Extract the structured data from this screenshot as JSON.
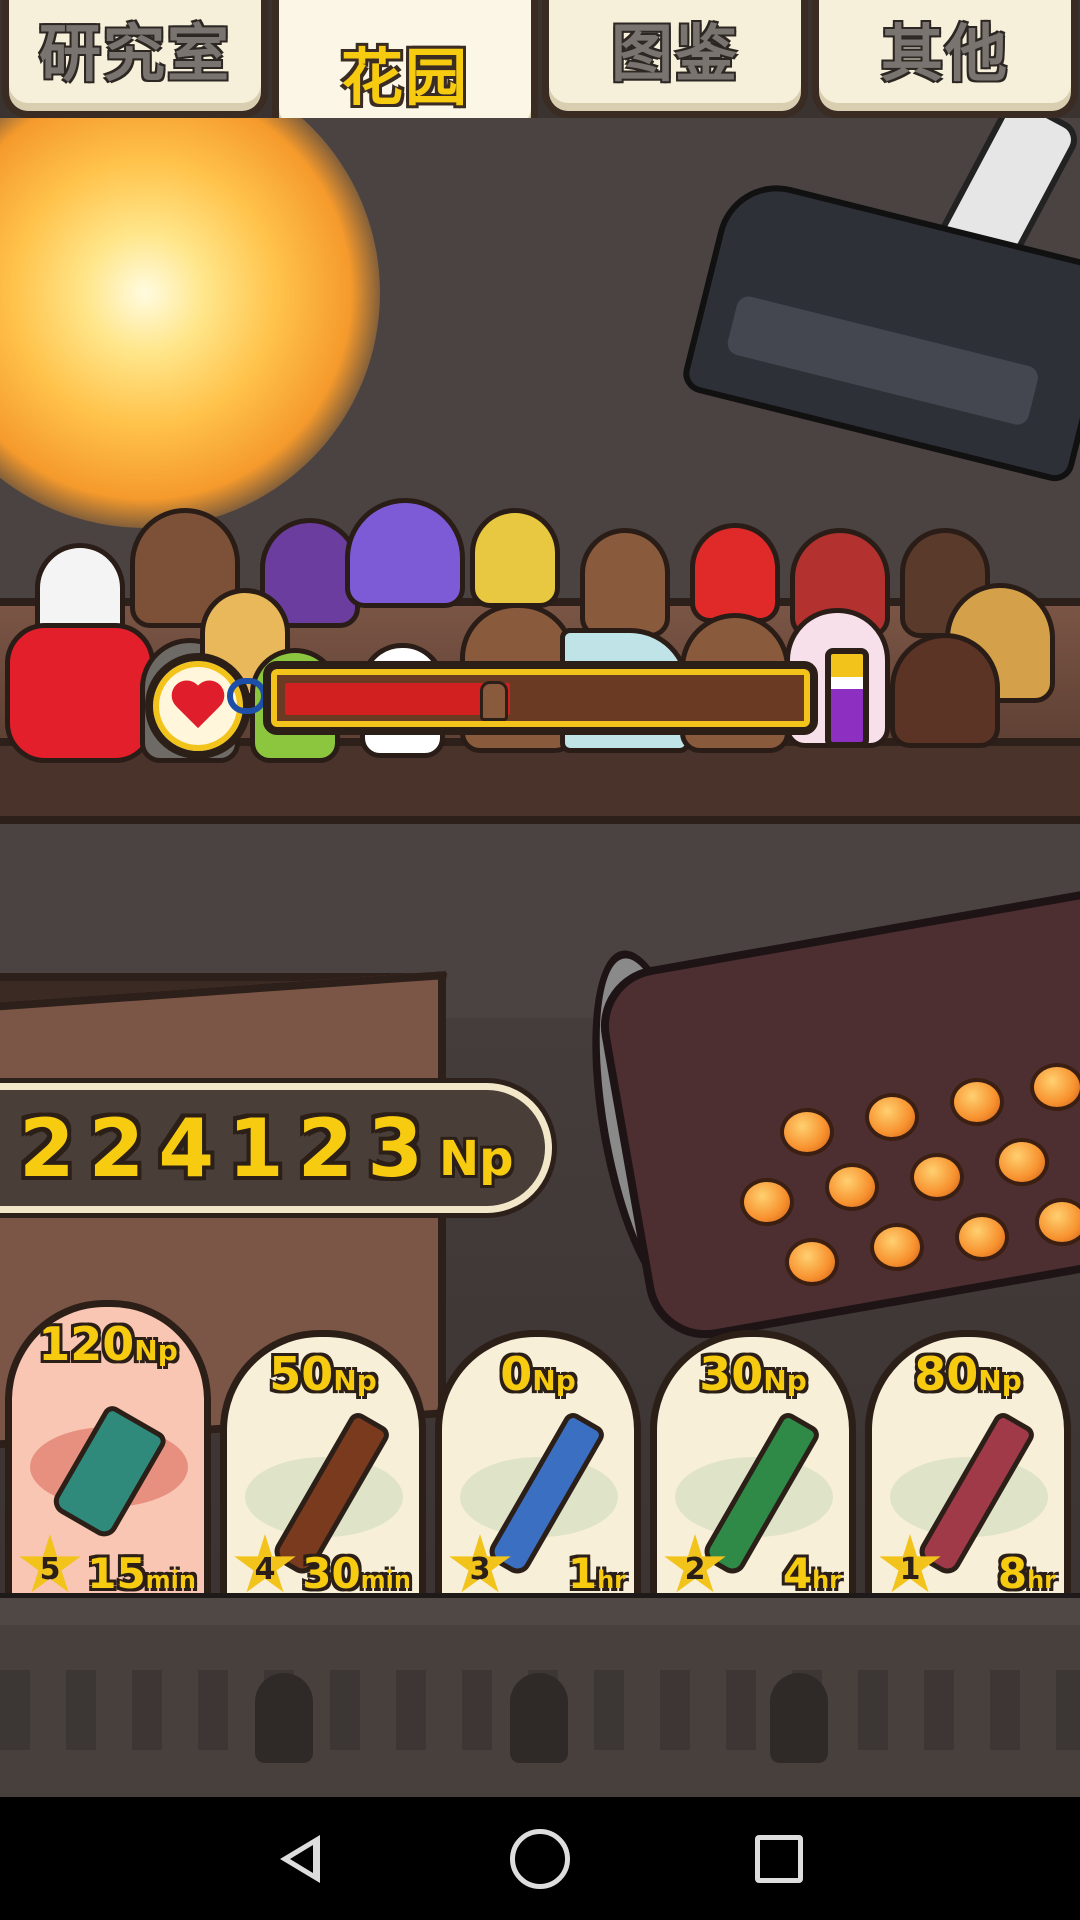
{
  "tabs": [
    {
      "label": "研究室",
      "active": false
    },
    {
      "label": "花园",
      "active": true
    },
    {
      "label": "图鉴",
      "active": false
    },
    {
      "label": "其他",
      "active": false
    }
  ],
  "growth_meter": {
    "fill_fraction": 0.44
  },
  "np_balance": {
    "value": "224123",
    "unit": "Np"
  },
  "items": [
    {
      "price": "120",
      "price_unit": "Np",
      "stars": "5",
      "time": "15",
      "time_unit": "min",
      "selected": true,
      "color": "#2f8a7c"
    },
    {
      "price": "50",
      "price_unit": "Np",
      "stars": "4",
      "time": "30",
      "time_unit": "min",
      "selected": false,
      "color": "#7a3a1e"
    },
    {
      "price": "0",
      "price_unit": "Np",
      "stars": "3",
      "time": "1",
      "time_unit": "hr",
      "selected": false,
      "color": "#3a6fc2"
    },
    {
      "price": "30",
      "price_unit": "Np",
      "stars": "2",
      "time": "4",
      "time_unit": "hr",
      "selected": false,
      "color": "#2f8a48"
    },
    {
      "price": "80",
      "price_unit": "Np",
      "stars": "1",
      "time": "8",
      "time_unit": "hr",
      "selected": false,
      "color": "#a03a48"
    }
  ],
  "colors": {
    "accent_yellow": "#f7cb10",
    "meter_red": "#d21f1f",
    "outline": "#2b1f18"
  }
}
